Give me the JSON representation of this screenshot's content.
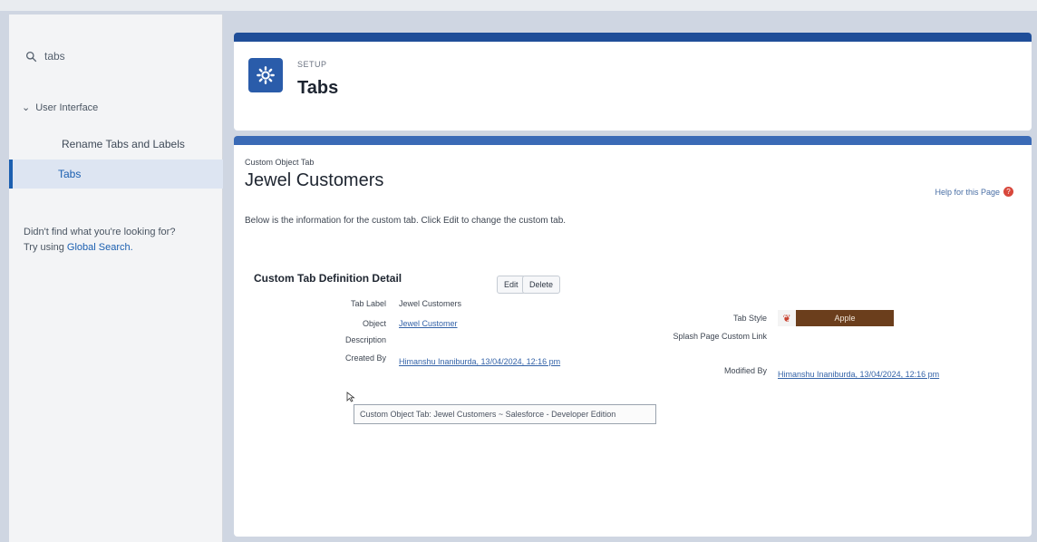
{
  "sidebar": {
    "search_value": "tabs",
    "tree_parent": "User Interface",
    "items": [
      "Rename Tabs and Labels",
      "Tabs"
    ],
    "didnt_find_line1": "Didn't find what you're looking for?",
    "didnt_find_try": "Try using",
    "didnt_find_link": "Global Search."
  },
  "header": {
    "eyebrow": "SETUP",
    "title": "Tabs",
    "accent": "#2a5caa"
  },
  "detail": {
    "object_type": "Custom Object Tab",
    "title": "Jewel Customers",
    "help_link": "Help for this Page",
    "intro": "Below is the information for the custom tab. Click Edit to change the custom tab.",
    "section_title": "Custom Tab Definition Detail",
    "edit_label": "Edit",
    "delete_label": "Delete",
    "fields": {
      "tab_label_label": "Tab Label",
      "tab_label_value": "Jewel Customers",
      "object_label": "Object",
      "object_value": "Jewel Customer",
      "description_label": "Description",
      "created_by_label": "Created By",
      "created_by_value": "Himanshu Inaniburda, 13/04/2024, 12:16 pm",
      "tab_style_label": "Tab Style",
      "tab_style_value": "Apple",
      "splash_label": "Splash Page Custom Link",
      "modified_by_label": "Modified By",
      "modified_by_value": "Himanshu Inaniburda, 13/04/2024, 12:16 pm"
    },
    "tooltip": "Custom Object Tab: Jewel Customers ~ Salesforce - Developer Edition",
    "tab_style_color": "#6b3e1c"
  }
}
